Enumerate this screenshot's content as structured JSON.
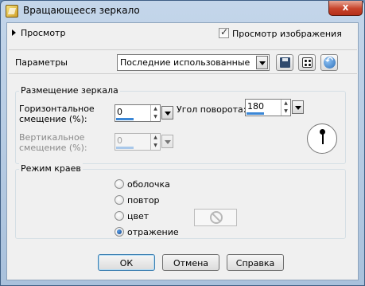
{
  "window": {
    "title": "Вращающееся зеркало",
    "close_label": "x"
  },
  "preview": {
    "toggle_label": "Просмотр",
    "image_checkbox_label": "Просмотр изображения",
    "image_checked": true
  },
  "params": {
    "label": "Параметры",
    "preset_value": "Последние использованные"
  },
  "mirror_group": {
    "caption": "Размещение зеркала",
    "horizontal_label_1": "Горизонтальное",
    "horizontal_label_2": "смещение (%):",
    "horizontal_value": "0",
    "horizontal_level": 0.5,
    "vertical_label_1": "Вертикальное",
    "vertical_label_2": "смещение (%):",
    "vertical_value": "0",
    "vertical_level": 0.5,
    "rotation_label": "Угол поворота:",
    "rotation_value": "180",
    "rotation_level": 0.5
  },
  "edge_group": {
    "caption": "Режим краев",
    "options": [
      "оболочка",
      "повтор",
      "цвет",
      "отражение"
    ],
    "selected_index": 3
  },
  "buttons": {
    "ok": "ОК",
    "cancel": "Отмена",
    "help": "Справка"
  },
  "colors": {
    "accent": "#3b87d6",
    "title_close": "#c7432a"
  }
}
